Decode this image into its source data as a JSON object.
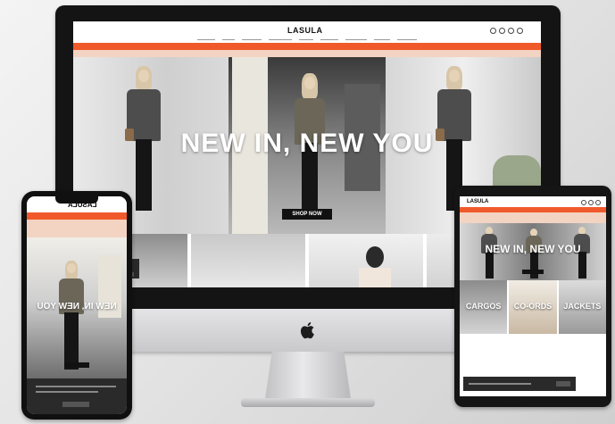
{
  "desktop": {
    "logo": "LASULA",
    "hero_title": "NEW IN, NEW YOU",
    "shop_button": "SHOP NOW"
  },
  "tablet": {
    "logo": "LASULA",
    "hero_title": "NEW IN, NEW YOU",
    "tiles": [
      "CARGOS",
      "CO-ORDS",
      "JACKETS"
    ]
  },
  "phone": {
    "logo": "LASULA",
    "hero_title": "NEW IN, NEW YOU"
  },
  "colors": {
    "promo_bar": "#f05a2b",
    "info_bar": "#f3d3c2",
    "device_silver": "#d7d7d9",
    "device_black": "#141414"
  },
  "icons": [
    "apple-logo-icon",
    "search-icon",
    "account-icon",
    "wishlist-icon",
    "bag-icon"
  ]
}
